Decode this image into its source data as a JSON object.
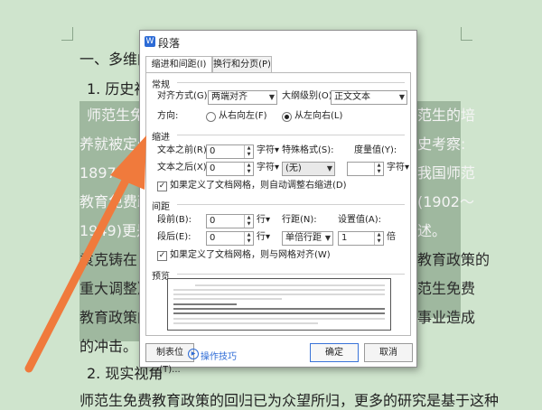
{
  "document": {
    "heading_main": "一、多维的",
    "heading_sub1": "1. 历史视角",
    "hl_lines": [
      {
        "left": "师范生免费",
        "right": "范生的培"
      },
      {
        "left": "养就被定位",
        "right": "史考察:"
      },
      {
        "left": "1897～194",
        "right": "我国师范"
      },
      {
        "left": "教育免费政",
        "right": "(1902～"
      },
      {
        "left": "1949)更是",
        "right": "述。"
      },
      {
        "left": "袁克铸在",
        "right": "教育政策的"
      },
      {
        "left": "重大调整》",
        "right": "范生免费"
      },
      {
        "left": "教育政策的",
        "right": "事业造成"
      }
    ],
    "line_impact": "的冲击。",
    "heading_sub2": "2. 现实视角",
    "last_line": "师范生免费教育政策的回归已为众望所归，更多的研究是基于这种"
  },
  "dialog": {
    "app_icon_text": "W",
    "title": "段落",
    "tabs": [
      "缩进和间距(I)",
      "换行和分页(P)"
    ],
    "general": {
      "section": "常规",
      "align_label": "对齐方式(G):",
      "align_value": "两端对齐",
      "outline_label": "大纲级别(O):",
      "outline_value": "正文文本",
      "direction_label": "方向:",
      "rtl_label": "从右向左(F)",
      "ltr_label": "从左向右(L)"
    },
    "indent": {
      "section": "缩进",
      "before_label": "文本之前(R):",
      "before_value": "0",
      "before_unit": "字符▾",
      "after_label": "文本之后(X):",
      "after_value": "0",
      "after_unit": "字符▾",
      "special_label": "特殊格式(S):",
      "special_value": "(无)",
      "measure_label": "度量值(Y):",
      "measure_value": "",
      "measure_unit": "字符▾",
      "grid_auto_label": "如果定义了文档网格，则自动调整右缩进(D)"
    },
    "spacing": {
      "section": "间距",
      "before_label": "段前(B):",
      "before_value": "0",
      "before_unit": "行▾",
      "after_label": "段后(E):",
      "after_value": "0",
      "after_unit": "行▾",
      "line_label": "行距(N):",
      "line_value": "单倍行距",
      "setting_label": "设置值(A):",
      "setting_value": "1",
      "setting_unit": "倍",
      "grid_snap_label": "如果定义了文档网格，则与网格对齐(W)"
    },
    "preview": {
      "section": "预览"
    },
    "tabs_button": "制表位(T)...",
    "tips_label": "操作技巧",
    "ok_button": "确定",
    "cancel_button": "取消"
  },
  "colors": {
    "page_bg": "#cfe4cd",
    "highlight": "#9fb89f",
    "arrow": "#f07a3c",
    "accent": "#2d6bd6"
  }
}
